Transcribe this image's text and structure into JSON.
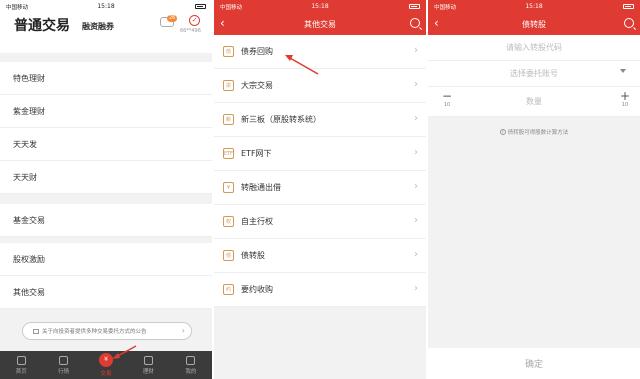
{
  "status_bar": {
    "carrier": "中国移动",
    "time": "15:18"
  },
  "panel1": {
    "title": "普通交易",
    "subtitle": "融资融券",
    "badge": "26",
    "avatar": "✓",
    "account": "66**496",
    "menu_group1": [
      "特色理财",
      "紫金理财",
      "天天发",
      "天天财"
    ],
    "menu_group2": [
      "基金交易"
    ],
    "menu_group3": [
      "股权激励",
      "其他交易"
    ],
    "notice": "关于向投资者提供多种交易委托方式的公告",
    "tabs": [
      "首页",
      "行情",
      "交易",
      "理财",
      "我的"
    ]
  },
  "panel2": {
    "title": "其他交易",
    "items": [
      {
        "label": "债券回购",
        "icon": "债"
      },
      {
        "label": "大宗交易",
        "icon": "宗"
      },
      {
        "label": "新三板（原股转系统）",
        "icon": "新"
      },
      {
        "label": "ETF网下",
        "icon": "ETF"
      },
      {
        "label": "转融通出借",
        "icon": "¥"
      },
      {
        "label": "自主行权",
        "icon": "权"
      },
      {
        "label": "债转股",
        "icon": "债"
      },
      {
        "label": "要约收购",
        "icon": "约"
      }
    ]
  },
  "panel3": {
    "title": "债转股",
    "code_placeholder": "请输入转股代码",
    "account_placeholder": "选择委托账号",
    "quantity_placeholder": "数量",
    "step_minus": "10",
    "step_plus": "10",
    "help": "债转股可得股数计算方法",
    "confirm": "确定"
  },
  "colors": {
    "accent": "#e03b33",
    "tab_bar": "#3b3b3b"
  }
}
